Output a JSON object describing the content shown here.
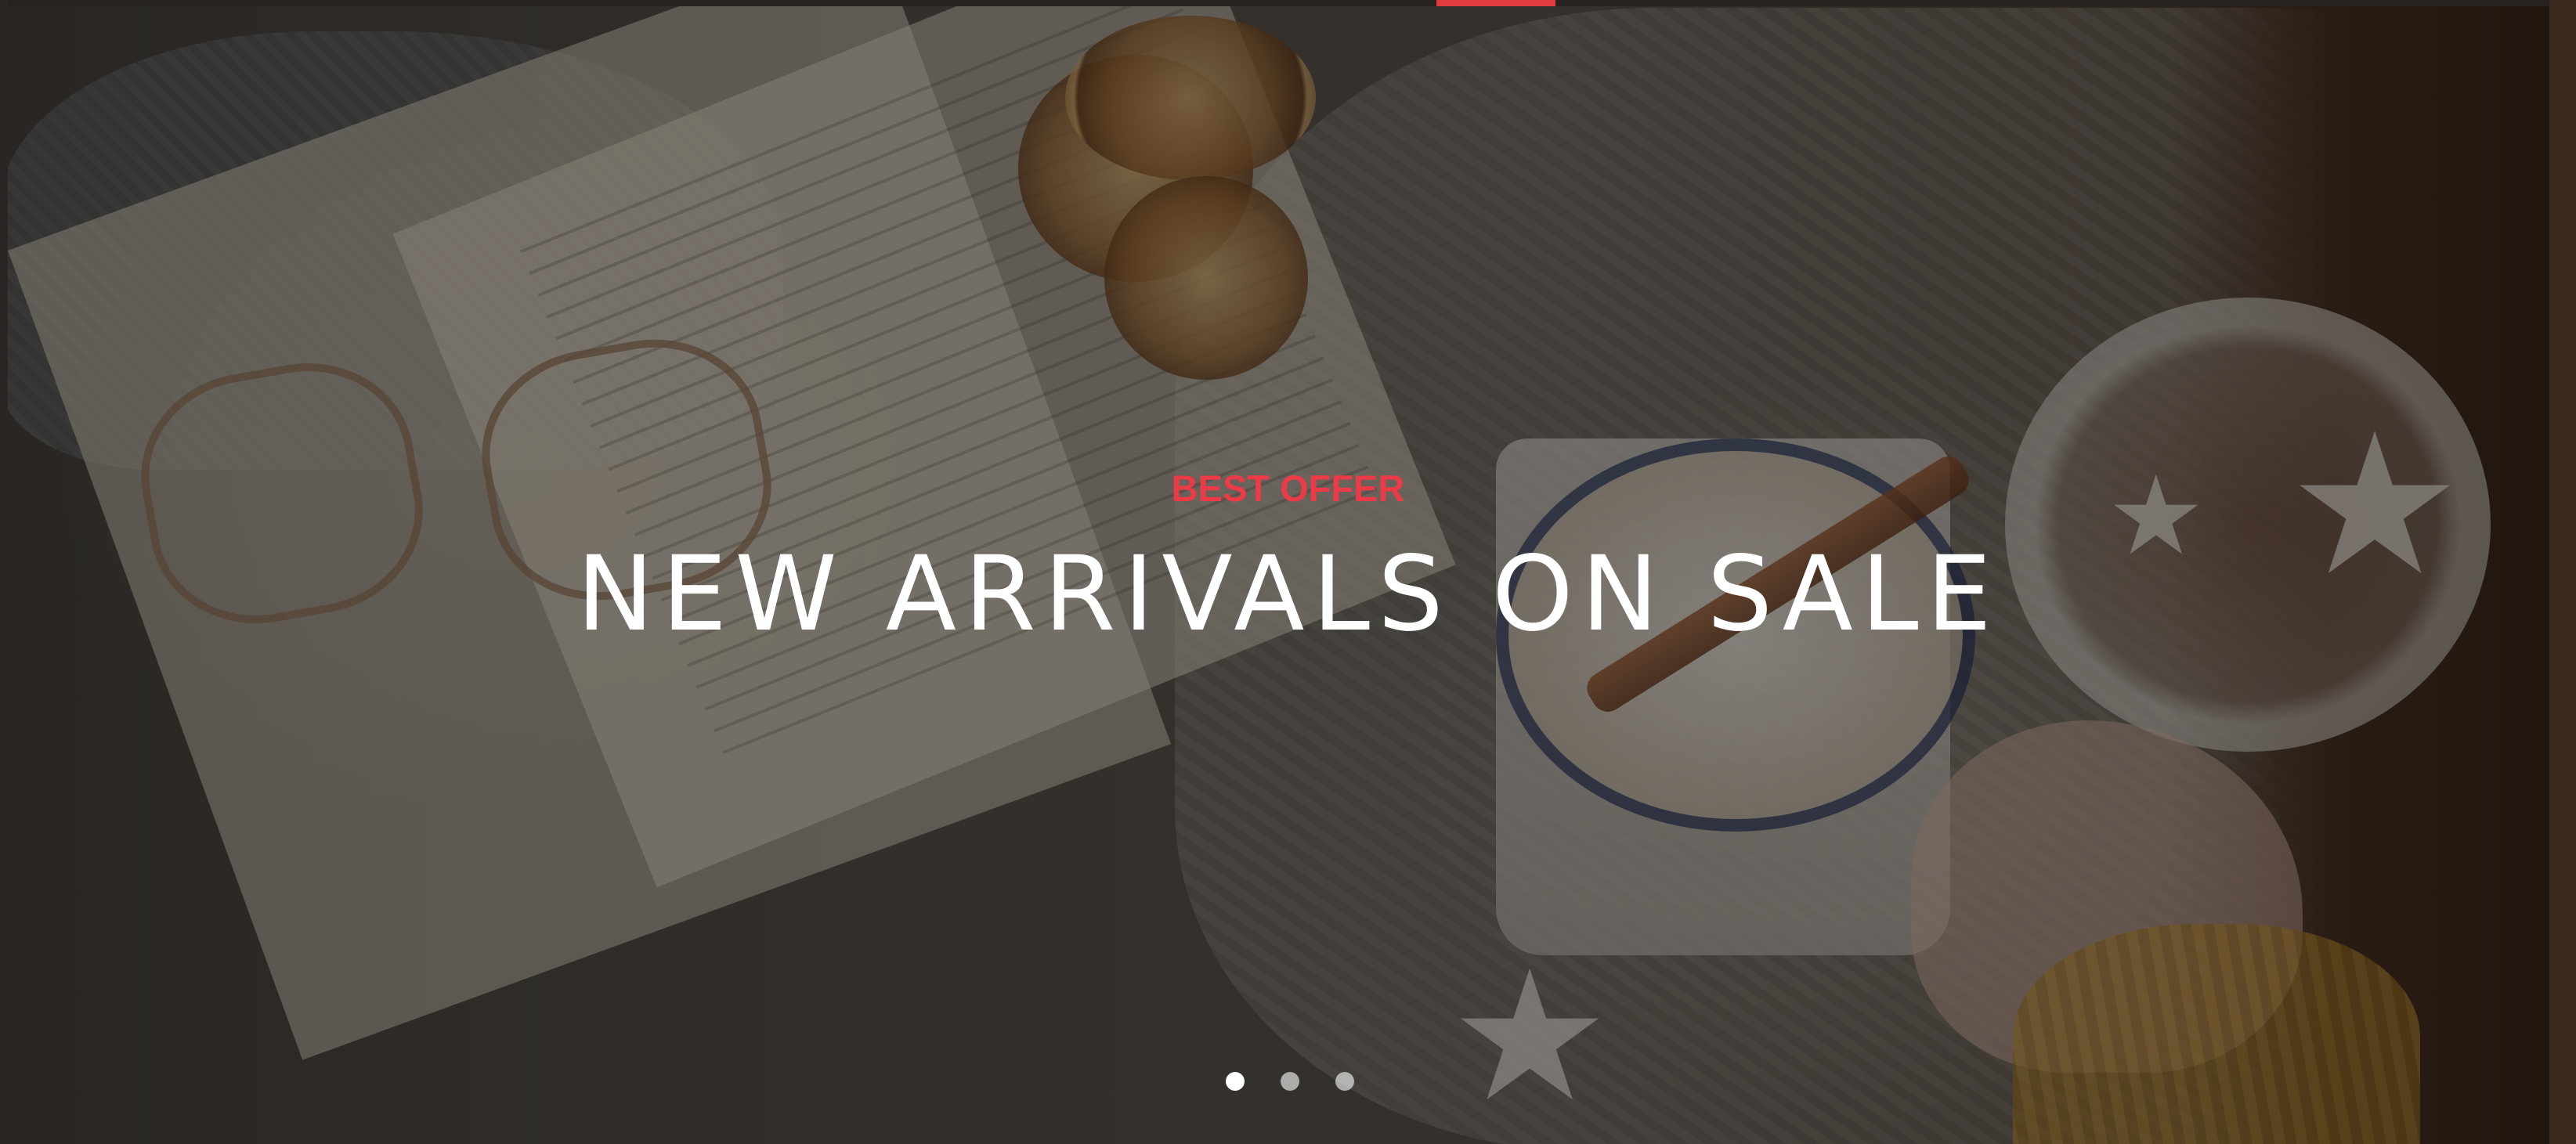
{
  "slider": {
    "eyebrow": "BEST OFFER",
    "headline": "NEW ARRIVALS ON SALE",
    "slide_count": 3,
    "active_slide": 1,
    "accent_color": "#ec3b46",
    "headline_color": "#ffffff",
    "dots": [
      {
        "label": "slide 1",
        "active": true
      },
      {
        "label": "slide 2",
        "active": false
      },
      {
        "label": "slide 3",
        "active": false
      }
    ]
  },
  "background_image": {
    "icon": "hero-photo",
    "subject": "open book, glasses, dried orange slices, mug of cocoa with marshmallows and cinnamon, bowl of sugar and star cookies on knitted blanket"
  }
}
